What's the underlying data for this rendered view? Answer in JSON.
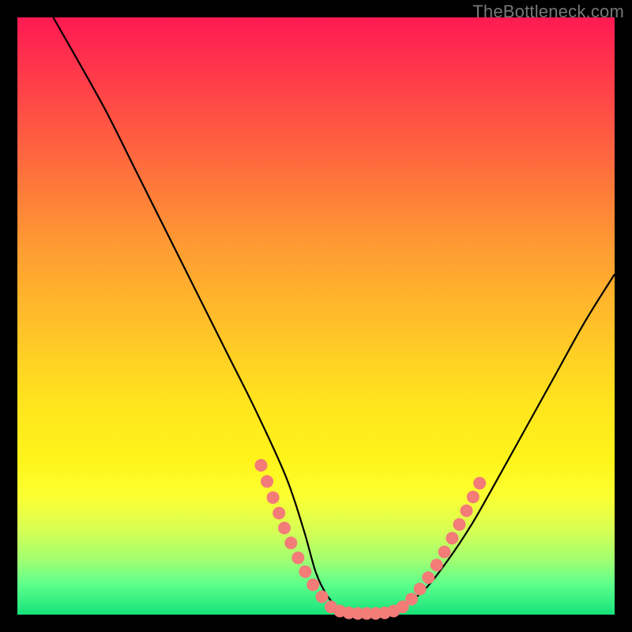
{
  "watermark": "TheBottleneck.com",
  "chart_data": {
    "type": "line",
    "title": "",
    "xlabel": "",
    "ylabel": "",
    "xlim": [
      0,
      100
    ],
    "ylim": [
      0,
      100
    ],
    "grid": false,
    "legend": false,
    "background_gradient": [
      "#ff1a53",
      "#ffe31e",
      "#17e27a"
    ],
    "series": [
      {
        "name": "bottleneck-curve",
        "color": "#000000",
        "x": [
          6,
          10,
          15,
          20,
          25,
          30,
          35,
          40,
          45,
          48,
          50,
          52,
          54,
          56,
          58,
          60,
          62,
          64,
          68,
          72,
          76,
          80,
          85,
          90,
          95,
          100
        ],
        "y": [
          100,
          93,
          84,
          74,
          64,
          54,
          44,
          34,
          23,
          14,
          7,
          3,
          1,
          0,
          0,
          0,
          0,
          1,
          4,
          9,
          15,
          22,
          31,
          40,
          49,
          57
        ]
      }
    ],
    "markers": [
      {
        "name": "left-dots",
        "color": "#f37b78",
        "radius": 8,
        "points": [
          {
            "x": 40.8,
            "y": 25.0
          },
          {
            "x": 41.8,
            "y": 22.3
          },
          {
            "x": 42.8,
            "y": 19.6
          },
          {
            "x": 43.8,
            "y": 17.0
          },
          {
            "x": 44.7,
            "y": 14.5
          },
          {
            "x": 45.8,
            "y": 12.0
          },
          {
            "x": 47.0,
            "y": 9.5
          },
          {
            "x": 48.2,
            "y": 7.2
          },
          {
            "x": 49.5,
            "y": 5.0
          },
          {
            "x": 51.0,
            "y": 3.0
          }
        ]
      },
      {
        "name": "floor-dots",
        "color": "#f37b78",
        "radius": 8,
        "points": [
          {
            "x": 52.5,
            "y": 1.3
          },
          {
            "x": 54.0,
            "y": 0.6
          },
          {
            "x": 55.5,
            "y": 0.3
          },
          {
            "x": 57.0,
            "y": 0.2
          },
          {
            "x": 58.5,
            "y": 0.2
          },
          {
            "x": 60.0,
            "y": 0.2
          },
          {
            "x": 61.5,
            "y": 0.3
          },
          {
            "x": 63.0,
            "y": 0.6
          },
          {
            "x": 64.5,
            "y": 1.3
          }
        ]
      },
      {
        "name": "right-dots",
        "color": "#f37b78",
        "radius": 8,
        "points": [
          {
            "x": 66.0,
            "y": 2.6
          },
          {
            "x": 67.4,
            "y": 4.3
          },
          {
            "x": 68.8,
            "y": 6.2
          },
          {
            "x": 70.2,
            "y": 8.3
          },
          {
            "x": 71.5,
            "y": 10.5
          },
          {
            "x": 72.8,
            "y": 12.8
          },
          {
            "x": 74.0,
            "y": 15.1
          },
          {
            "x": 75.2,
            "y": 17.4
          },
          {
            "x": 76.3,
            "y": 19.7
          },
          {
            "x": 77.4,
            "y": 22.0
          }
        ]
      }
    ]
  }
}
